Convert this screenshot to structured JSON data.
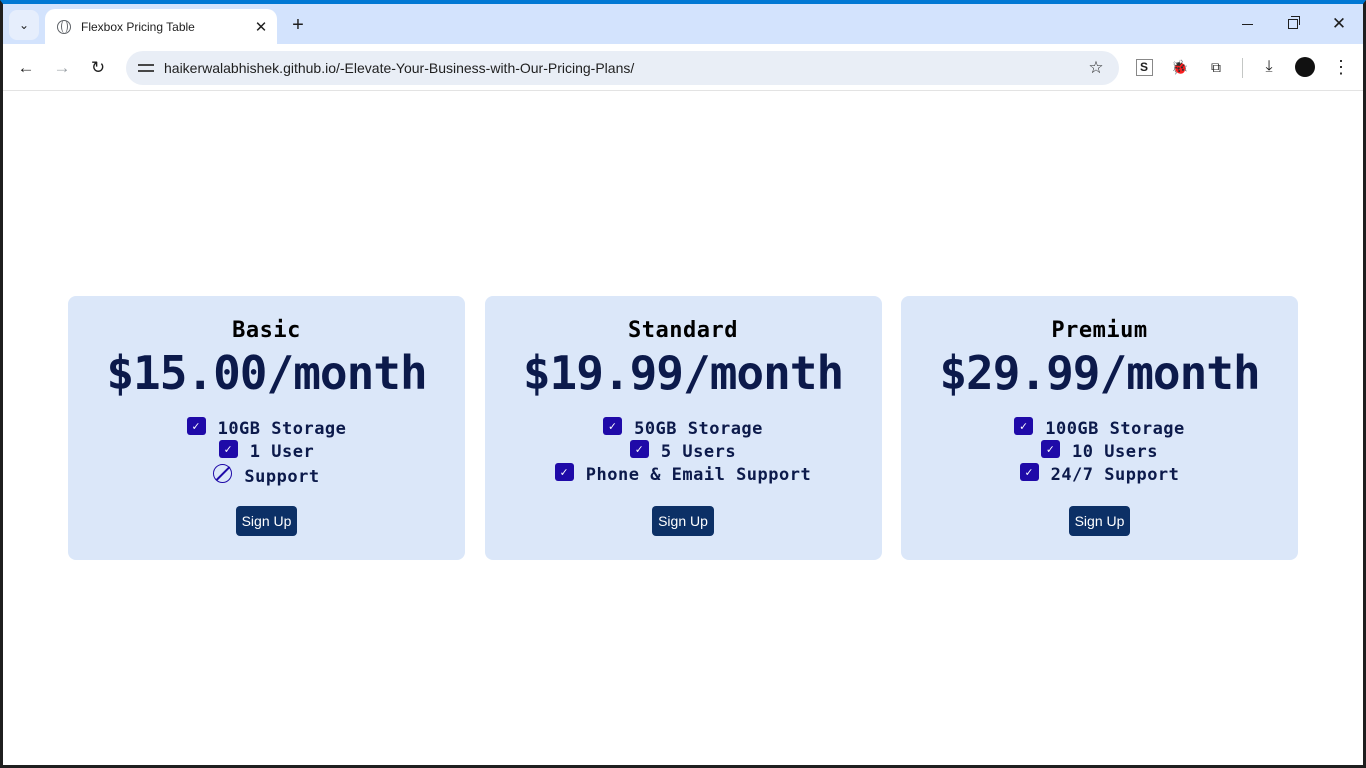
{
  "browser": {
    "tab_title": "Flexbox Pricing Table",
    "url": "haikerwalabhishek.github.io/-Elevate-Your-Business-with-Our-Pricing-Plans/",
    "icons": [
      "tab-search-icon",
      "globe-icon",
      "close-icon",
      "plus-icon",
      "back-icon",
      "forward-icon",
      "reload-icon",
      "tune-icon",
      "star-icon",
      "s-extension-icon",
      "bug-icon",
      "puzzle-icon",
      "download-icon",
      "avatar",
      "more-icon"
    ]
  },
  "plans": [
    {
      "name": "Basic",
      "price": "$15.00/month",
      "features": [
        {
          "text": "10GB Storage",
          "included": true
        },
        {
          "text": "1 User",
          "included": true
        },
        {
          "text": "Support",
          "included": false
        }
      ],
      "button": "Sign Up"
    },
    {
      "name": "Standard",
      "price": "$19.99/month",
      "features": [
        {
          "text": "50GB Storage",
          "included": true
        },
        {
          "text": "5 Users",
          "included": true
        },
        {
          "text": "Phone & Email Support",
          "included": true
        }
      ],
      "button": "Sign Up"
    },
    {
      "name": "Premium",
      "price": "$29.99/month",
      "features": [
        {
          "text": "100GB Storage",
          "included": true
        },
        {
          "text": "10 Users",
          "included": true
        },
        {
          "text": "24/7 Support",
          "included": true
        }
      ],
      "button": "Sign Up"
    }
  ],
  "colors": {
    "card_bg": "#dbe7f9",
    "price_text": "#0c1a4b",
    "checkbox": "#1f0aa8",
    "button_bg": "#0c3066"
  }
}
